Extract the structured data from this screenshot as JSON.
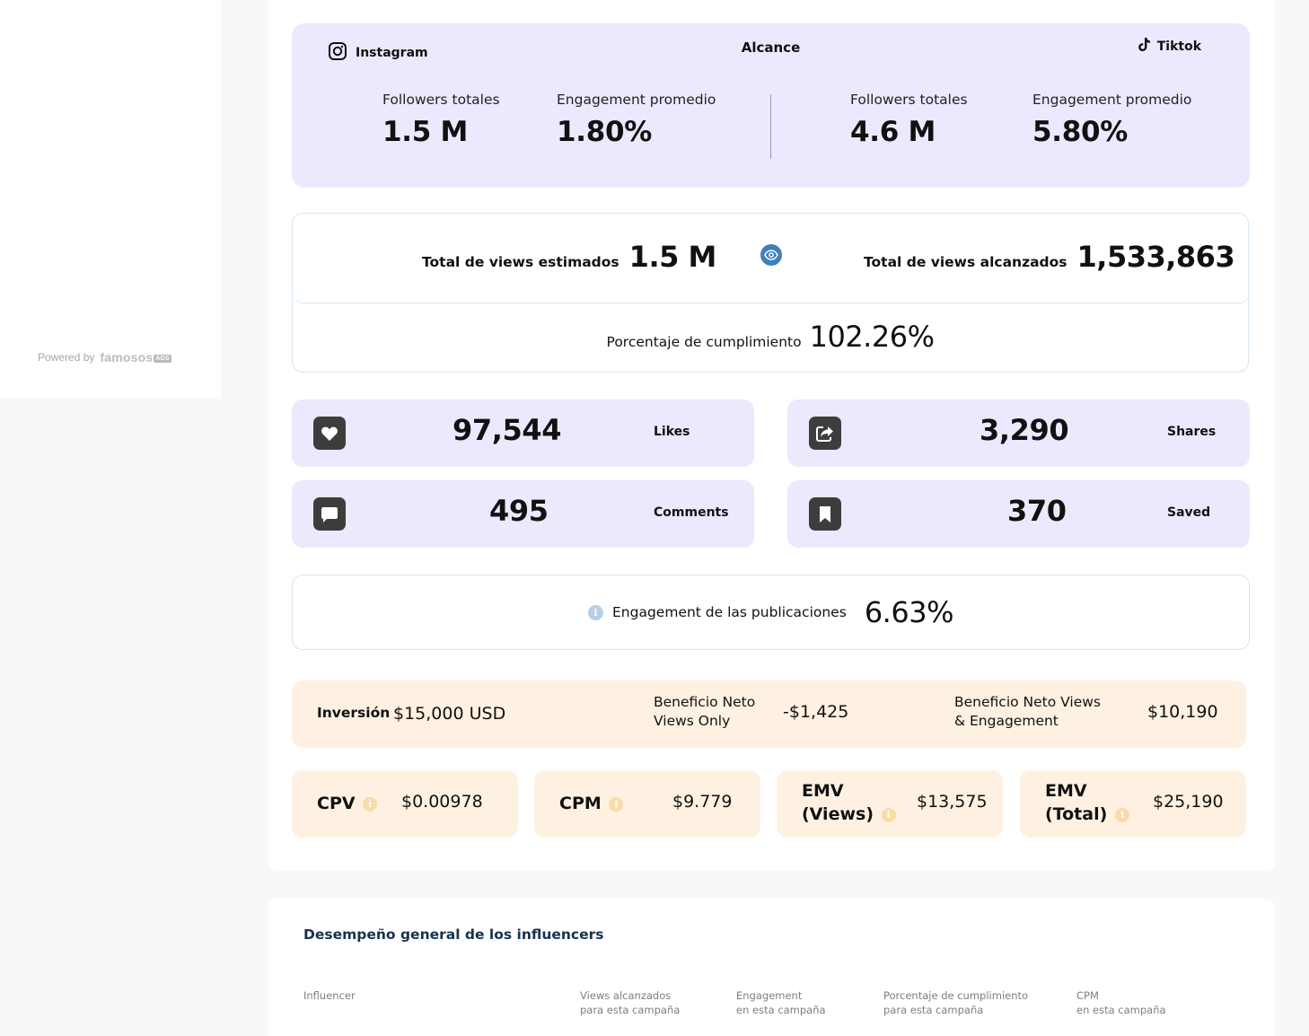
{
  "sidebar": {
    "powered_by": "Powered by",
    "brand": "famosos",
    "brand_badge": "ADS"
  },
  "reach": {
    "instagram_label": "Instagram",
    "title": "Alcance",
    "tiktok_label": "Tiktok",
    "instagram": {
      "followers_label": "Followers totales",
      "followers_value": "1.5 M",
      "engagement_label": "Engagement promedio",
      "engagement_value": "1.80%"
    },
    "tiktok": {
      "followers_label": "Followers totales",
      "followers_value": "4.6 M",
      "engagement_label": "Engagement promedio",
      "engagement_value": "5.80%"
    }
  },
  "views": {
    "estimated_label": "Total de views estimados",
    "estimated_value": "1.5 M",
    "reached_label": "Total de views alcanzados",
    "reached_value": "1,533,863",
    "compliance_label": "Porcentaje de cumplimiento",
    "compliance_value": "102.26%"
  },
  "metrics": {
    "likes": {
      "value": "97,544",
      "label": "Likes"
    },
    "shares": {
      "value": "3,290",
      "label": "Shares"
    },
    "comments": {
      "value": "495",
      "label": "Comments"
    },
    "saved": {
      "value": "370",
      "label": "Saved"
    }
  },
  "engagement": {
    "label": "Engagement de las publicaciones",
    "value": "6.63%"
  },
  "investment": {
    "label": "Inversión",
    "value": "$15,000 USD",
    "net_views_label_1": "Beneficio Neto",
    "net_views_label_2": "Views Only",
    "net_views_value": "-$1,425",
    "net_total_label_1": "Beneficio Neto Views",
    "net_total_label_2": "& Engagement",
    "net_total_value": "$10,190"
  },
  "kpis": {
    "cpv": {
      "label": "CPV",
      "value": "$0.00978"
    },
    "cpm": {
      "label": "CPM",
      "value": "$9.779"
    },
    "emv_views": {
      "label_1": "EMV",
      "label_2": "(Views)",
      "value": "$13,575"
    },
    "emv_total": {
      "label_1": "EMV",
      "label_2": "(Total)",
      "value": "$25,190"
    }
  },
  "info_glyph": "i",
  "performance": {
    "title": "Desempeño general de los influencers",
    "columns": [
      "Influencer",
      "Views alcanzados\npara esta campaña",
      "Engagement\nen esta campaña",
      "Porcentaje de cumplimiento\npara esta campaña",
      "CPM\nen esta campaña"
    ]
  }
}
